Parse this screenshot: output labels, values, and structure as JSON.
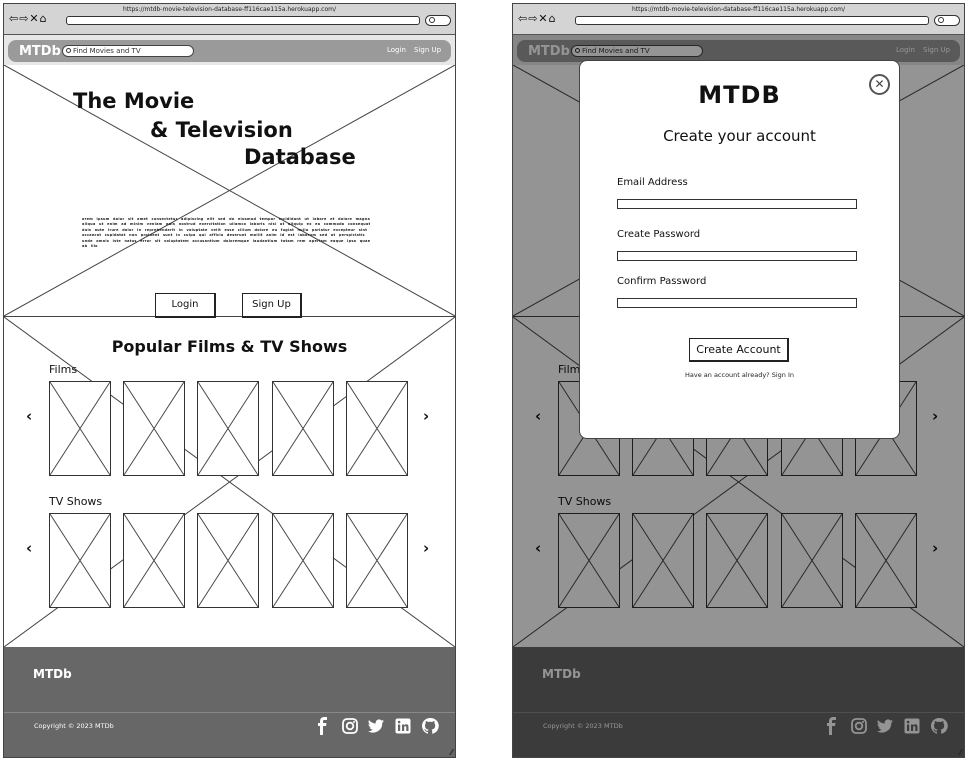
{
  "browser": {
    "url": "https://mtdb-movie-television-database-ff116cae115a.herokuapp.com/"
  },
  "header": {
    "logo": "MTDb",
    "search_placeholder": "Find Movies and TV",
    "login_label": "Login",
    "signup_label": "Sign Up"
  },
  "hero": {
    "title_line1": "The Movie",
    "title_line2": "& Television",
    "title_line3": "Database",
    "body_text": "orem ipsum dolor sit amet consectetur adipiscing elit sed do eiusmod tempor incididunt ut labore et dolore magna aliqua ut enim ad minim veniam quis nostrud exercitation ullamco laboris nisi ut aliquip ex ea commodo consequat duis aute irure dolor in reprehenderit in voluptate velit esse cillum dolore eu fugiat nulla pariatur excepteur sint occaecat cupidatat non proident sunt in culpa qui officia deserunt mollit anim id est laborum sed ut perspiciatis unde omnis iste natus error sit voluptatem accusantium doloremque laudantium totam rem aperiam eaque ipsa quae ab illo",
    "login_button": "Login",
    "signup_button": "Sign Up"
  },
  "popular": {
    "title": "Popular Films & TV Shows",
    "films_label": "Films",
    "tv_label": "TV Shows",
    "prev_arrow": "‹",
    "next_arrow": "›"
  },
  "footer": {
    "logo": "MTDb",
    "copyright": "Copyright © 2023 MTDb",
    "social_icons": [
      "facebook-icon",
      "instagram-icon",
      "twitter-icon",
      "linkedin-icon",
      "github-icon"
    ]
  },
  "modal": {
    "logo": "MTDB",
    "title": "Create your account",
    "close_glyph": "✕",
    "email_label": "Email Address",
    "password_label": "Create Password",
    "confirm_label": "Confirm Password",
    "submit_label": "Create Account",
    "signin_prompt": "Have an account already? Sign In"
  }
}
